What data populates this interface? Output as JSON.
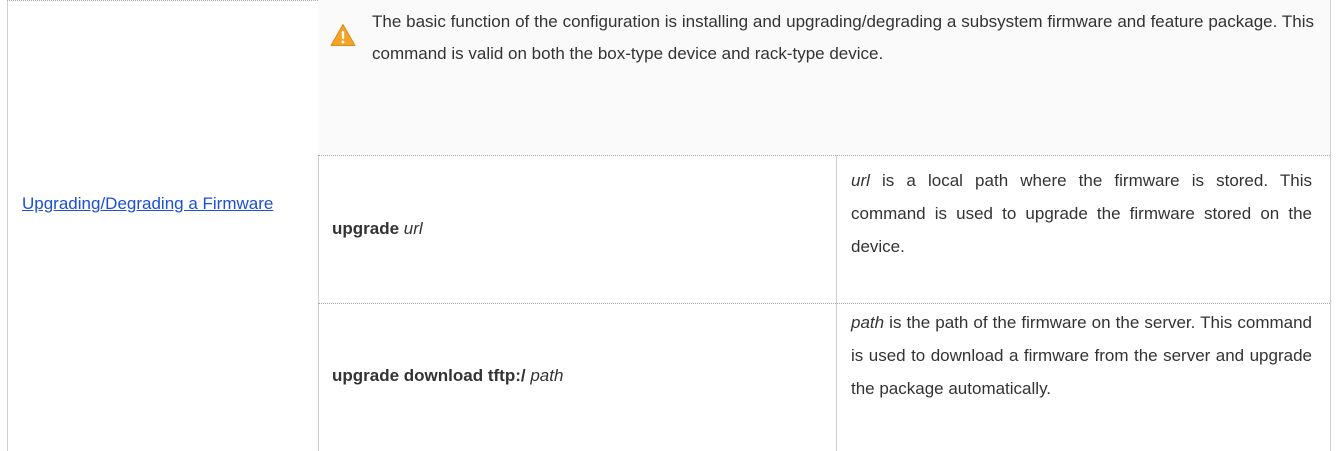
{
  "feature_link": "Upgrading/Degrading a Firmware",
  "note": {
    "icon": "warning-icon",
    "text": "The basic function of the configuration is installing and upgrading/degrading a subsystem firmware and feature package. This command is valid on both the box-type device and rack-type device."
  },
  "commands": [
    {
      "keyword": "upgrade",
      "param": "url",
      "desc_param": "url",
      "desc_rest": " is a local path where the firmware is stored. This command is used to upgrade the firmware stored on the device."
    },
    {
      "keyword": "upgrade download tftp:/",
      "param": "path",
      "desc_param": "path",
      "desc_rest": " is the path of the firmware on the server. This command is used to download a firmware from the server and upgrade the package automatically."
    }
  ],
  "colors": {
    "link": "#1a4fd6",
    "warning": "#f2a428",
    "border": "#cfcfcf"
  }
}
